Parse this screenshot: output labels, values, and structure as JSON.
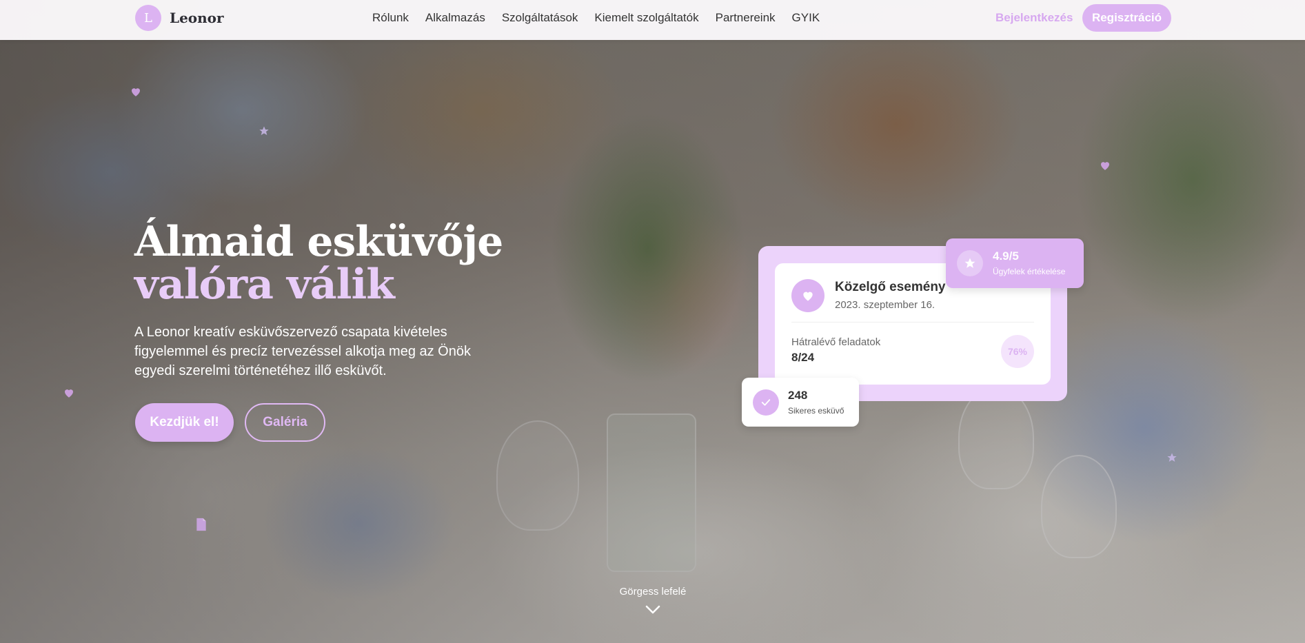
{
  "brand": {
    "initial": "L",
    "name": "Leonor",
    "accent_color": "#dcb3f2"
  },
  "nav": {
    "items": [
      "Rólunk",
      "Alkalmazás",
      "Szolgáltatások",
      "Kiemelt szolgáltatók",
      "Partnereink",
      "GYIK"
    ],
    "login": "Bejelentkezés",
    "register": "Regisztráció"
  },
  "hero": {
    "title_part1": "Álmaid esküvője",
    "title_accent": "valóra",
    "title_part2": "válik",
    "subtitle": "A Leonor kreatív esküvőszervező csapata kivételes figyelemmel és precíz tervezéssel alkotja meg az Önök egyedi szerelmi történetéhez illő esküvőt.",
    "primary_button": "Kezdjük el!",
    "secondary_button": "Galéria"
  },
  "event_card": {
    "icon": "heart-icon",
    "title": "Közelgő esemény",
    "date": "2023. szeptember 16.",
    "tasks_label": "Hátralévő feladatok",
    "tasks_value": "8/24",
    "progress": "76%"
  },
  "rating_card": {
    "icon": "star-icon",
    "value": "4.9/5",
    "label": "Ügyfelek értékelése"
  },
  "weddings_card": {
    "icon": "check-icon",
    "value": "248",
    "label": "Sikeres esküvő"
  },
  "scroll_hint": {
    "label": "Görgess lefelé",
    "icon": "chevron-down-icon"
  }
}
